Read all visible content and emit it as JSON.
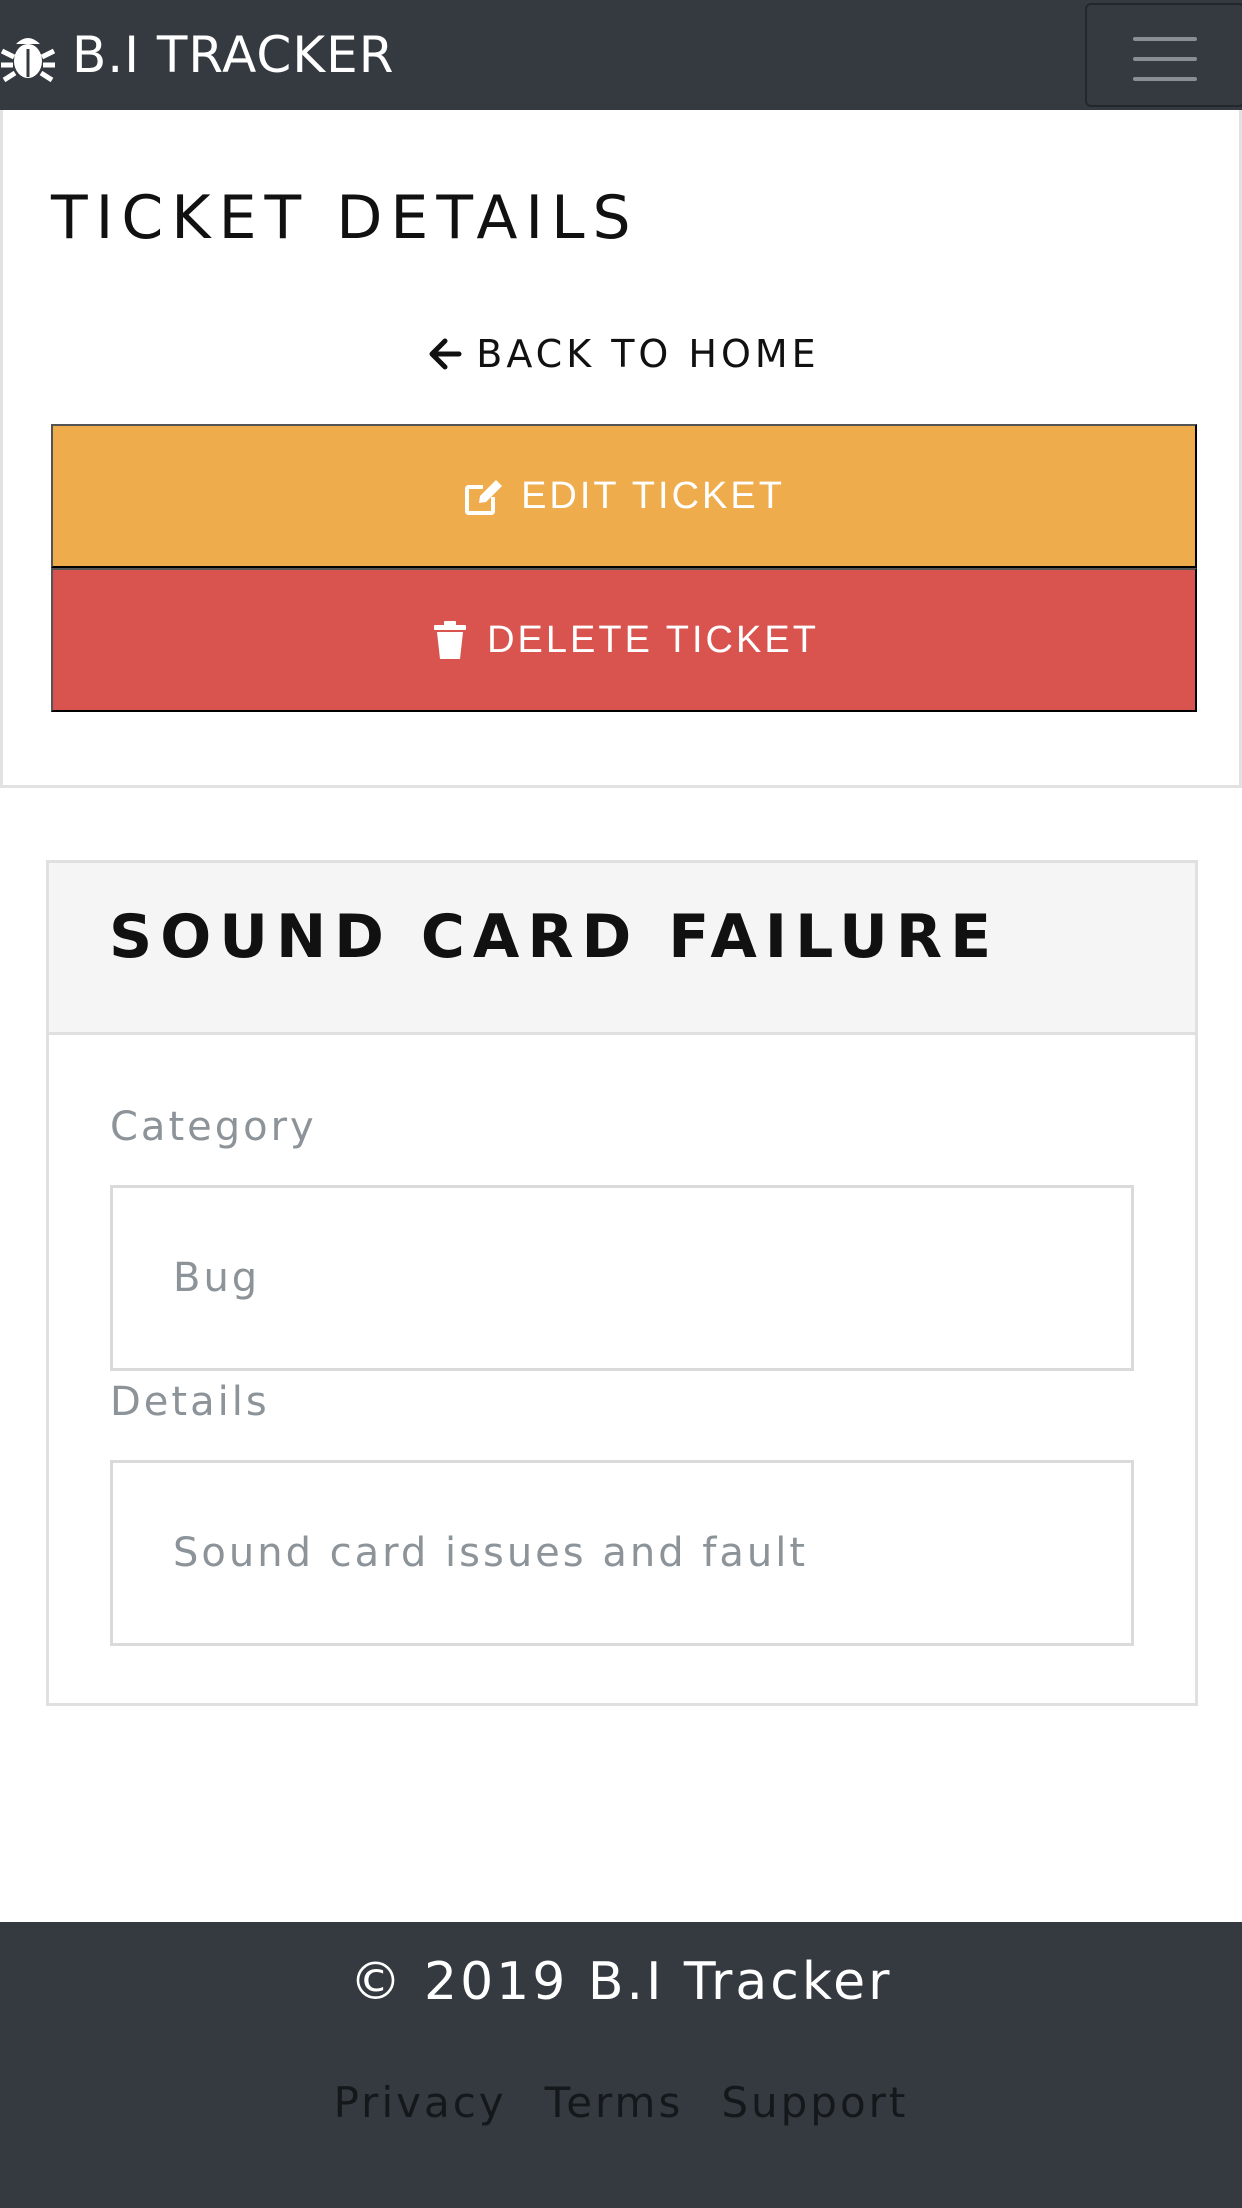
{
  "navbar": {
    "brand_icon": "bug-icon",
    "brand_text": "B.I TRACKER",
    "toggler_icon": "hamburger-menu-icon"
  },
  "top_card": {
    "title": "TICKET DETAILS",
    "back_icon": "arrow-left-icon",
    "back_label": "BACK TO HOME",
    "edit_icon": "edit-icon",
    "edit_label": "EDIT TICKET",
    "delete_icon": "trash-icon",
    "delete_label": "DELETE TICKET"
  },
  "ticket": {
    "title": "SOUND CARD FAILURE",
    "category_label": "Category",
    "category_value": "Bug",
    "details_label": "Details",
    "details_value": "Sound card issues and fault"
  },
  "footer": {
    "copyright": "© 2019 B.I Tracker",
    "links": [
      "Privacy",
      "Terms",
      "Support"
    ]
  },
  "colors": {
    "navbar_bg": "#343a40",
    "edit_button": "#eeac4c",
    "delete_button": "#d9534f",
    "muted_text": "#8c9399"
  }
}
